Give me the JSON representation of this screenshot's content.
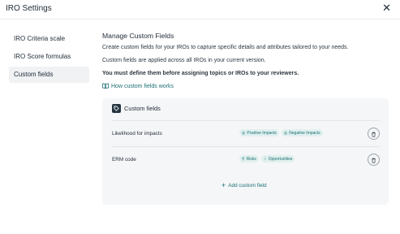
{
  "dialog": {
    "title": "IRO Settings",
    "close_symbol": "✕"
  },
  "sidebar": {
    "items": [
      {
        "label": "IRO Criteria scale",
        "active": false
      },
      {
        "label": "IRO Score formulas",
        "active": false
      },
      {
        "label": "Custom fields",
        "active": true
      }
    ]
  },
  "main": {
    "title": "Manage Custom Fields",
    "description": "Create custom fields for your IROs to capture specific details and attributes tailored to your needs.",
    "scope_note": "Custom fields are applied across all IROs in your current version.",
    "warning": "You must define them before assigning topics or IROs to your reviewers.",
    "help_link": "How custom fields works"
  },
  "custom_fields": {
    "title": "Custom fields",
    "rows": [
      {
        "label": "Likelihood for impacts",
        "chips": [
          "Positive Impacts",
          "Negative Impacts"
        ]
      },
      {
        "label": "ERM code",
        "chips": [
          "Risks",
          "Opportunities"
        ]
      }
    ],
    "add_label": "Add custom field",
    "add_symbol": "+"
  },
  "colors": {
    "accent": "#1e6f73",
    "chip_bg": "#e0f0ef",
    "card_bg": "#f5f6f7",
    "active_bg": "#f0f2f4"
  }
}
